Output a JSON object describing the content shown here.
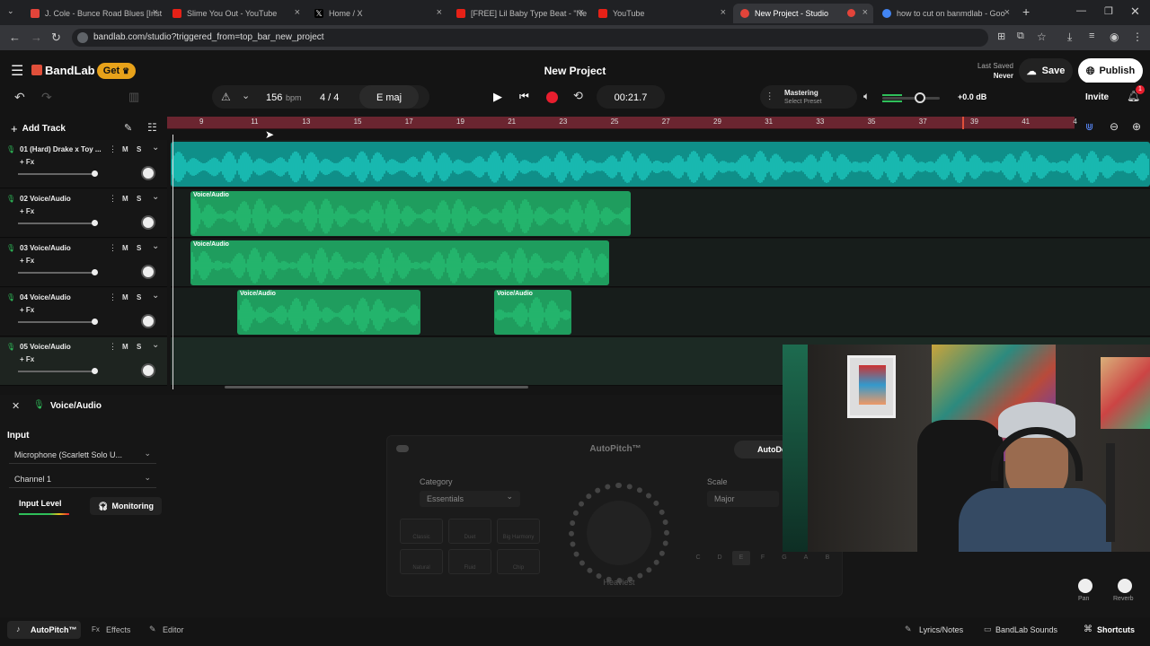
{
  "browser": {
    "tabs": [
      {
        "title": "J. Cole - Bunce Road Blues [Inst",
        "color": "#e3443a"
      },
      {
        "title": "Slime You Out - YouTube",
        "color": "#e62117"
      },
      {
        "title": "Home / X",
        "color": "#ffffff"
      },
      {
        "title": "[FREE] Lil Baby Type Beat - \"Ne",
        "color": "#e62117"
      },
      {
        "title": "YouTube",
        "color": "#e62117"
      },
      {
        "title": "New Project - Studio",
        "color": "#e3443a"
      },
      {
        "title": "how to cut on banmdlab - Goo",
        "color": "#4285f4"
      }
    ],
    "url": "bandlab.com/studio?triggered_from=top_bar_new_project",
    "close_glyph": "×",
    "new_tab_glyph": "+"
  },
  "header": {
    "menu_glyph": "☰",
    "brand": "BandLab",
    "get_label": "Get",
    "project_title": "New Project",
    "last_saved_label": "Last Saved",
    "last_saved_value": "Never",
    "save_label": "Save",
    "publish_label": "Publish",
    "invite_label": "Invite",
    "notif_count": "1",
    "accent": "#e04f3a"
  },
  "transport": {
    "bpm_value": "156",
    "bpm_unit": "bpm",
    "time_sig": "4 / 4",
    "key": "E maj",
    "time": "00:21.7",
    "mastering_label": "Mastering",
    "mastering_preset": "Select Preset",
    "volume_db": "+0.0 dB"
  },
  "ruler": {
    "ticks": [
      "9",
      "11",
      "13",
      "15",
      "17",
      "19",
      "21",
      "23",
      "25",
      "27",
      "29",
      "31",
      "33",
      "35",
      "37",
      "39",
      "41",
      "4"
    ]
  },
  "add_track_label": "Add Track",
  "tracks": [
    {
      "name": "01  (Hard) Drake x Toy ...",
      "fx": "+ Fx",
      "mute": "M",
      "solo": "S"
    },
    {
      "name": "02  Voice/Audio",
      "fx": "+ Fx",
      "mute": "M",
      "solo": "S"
    },
    {
      "name": "03  Voice/Audio",
      "fx": "+ Fx",
      "mute": "M",
      "solo": "S"
    },
    {
      "name": "04  Voice/Audio",
      "fx": "+ Fx",
      "mute": "M",
      "solo": "S"
    },
    {
      "name": "05  Voice/Audio",
      "fx": "+ Fx",
      "mute": "M",
      "solo": "S"
    }
  ],
  "clip_label": "Voice/Audio",
  "clip_colors": {
    "beat": "#1fd3c9",
    "voice": "#27c376"
  },
  "panel": {
    "title": "Voice/Audio",
    "input_label": "Input",
    "input_device": "Microphone (Scarlett Solo U...",
    "channel": "Channel 1",
    "input_level_label": "Input Level",
    "monitoring_label": "Monitoring",
    "autopitch_title": "AutoPitch™",
    "autodetect_label": "AutoDetect",
    "category_label": "Category",
    "category_value": "Essentials",
    "scale_label": "Scale",
    "scale_value": "Major",
    "effect_buttons": [
      "Classic",
      "Duet",
      "Big Harmony",
      "Natural",
      "Fluid",
      "Chip"
    ],
    "dial_label": "Heaviest",
    "notes": [
      "C",
      "D",
      "E",
      "F",
      "G",
      "A",
      "B"
    ],
    "pan_label": "Pan",
    "reverb_label": "Reverb"
  },
  "footer": {
    "autopitch": "AutoPitch™",
    "effects": "Effects",
    "editor": "Editor",
    "lyrics": "Lyrics/Notes",
    "sounds": "BandLab Sounds",
    "shortcuts": "Shortcuts"
  }
}
